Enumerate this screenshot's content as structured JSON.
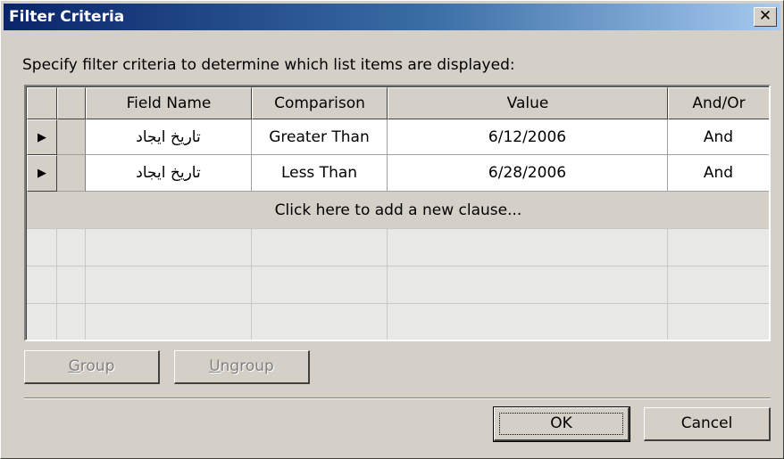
{
  "window": {
    "title": "Filter Criteria",
    "close_glyph": "✕"
  },
  "instruction": "Specify filter criteria to determine which list items are displayed:",
  "grid": {
    "columns": [
      "Field Name",
      "Comparison",
      "Value",
      "And/Or"
    ],
    "rows": [
      {
        "indicator": "▶",
        "field": "تاریخ ایجاد",
        "comparison": "Greater Than",
        "value": "6/12/2006",
        "andor": "And"
      },
      {
        "indicator": "▶",
        "field": "تاریخ ایجاد",
        "comparison": "Less Than",
        "value": "6/28/2006",
        "andor": "And"
      }
    ],
    "add_clause": "Click here to add a new clause..."
  },
  "buttons": {
    "group_prefix": "G",
    "group_rest": "roup",
    "ungroup_prefix": "U",
    "ungroup_rest": "ngroup",
    "ok": "OK",
    "cancel": "Cancel"
  }
}
